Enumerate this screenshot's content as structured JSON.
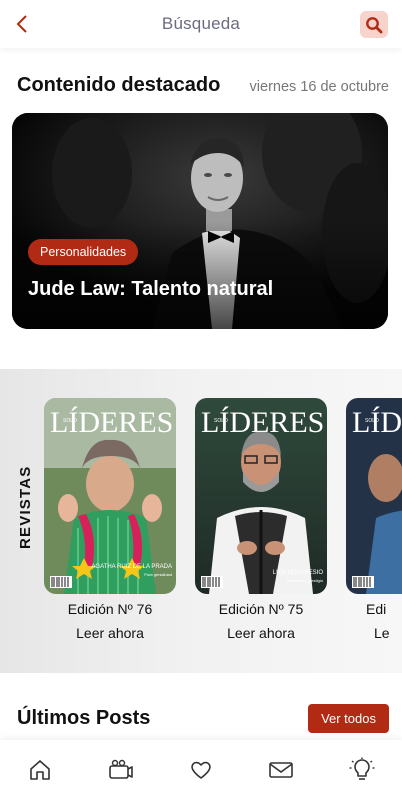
{
  "header": {
    "title": "Búsqueda",
    "back_icon": "chevron-left-icon",
    "search_icon": "search-icon"
  },
  "featured": {
    "title": "Contenido destacado",
    "date": "viernes 16 de octubre",
    "hero": {
      "category": "Personalidades",
      "headline": "Jude Law: Talento natural"
    }
  },
  "magazines": {
    "label": "REVISTAS",
    "items": [
      {
        "masthead": "LÍDERES",
        "masthead_small": "SOLO",
        "cover_name": "AGATHA RUIZ DE LA PRADA",
        "cover_sub": "Pura genialidad",
        "edition": "Edición Nº 76",
        "cta": "Leer ahora"
      },
      {
        "masthead": "LÍDERES",
        "masthead_small": "SOLO",
        "cover_name": "LUIS NOVARESIO",
        "cover_sub": "Sabiduría y prestigio",
        "edition": "Edición Nº 75",
        "cta": "Leer ahora"
      },
      {
        "masthead": "LÍDERES",
        "masthead_small": "SOLO",
        "edition": "Edi",
        "cta": "Le"
      }
    ]
  },
  "posts": {
    "title": "Últimos Posts",
    "see_all": "Ver todos"
  },
  "bottom_nav": {
    "items": [
      "home-icon",
      "camera-icon",
      "heart-icon",
      "mail-icon",
      "lightbulb-icon"
    ]
  },
  "colors": {
    "accent": "#b12b14",
    "accent_light": "#f7d3cc",
    "header_title": "#6b6b82"
  }
}
